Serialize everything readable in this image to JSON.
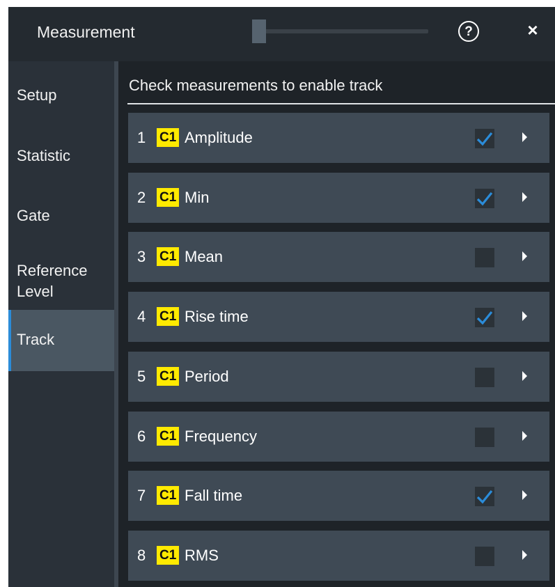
{
  "window": {
    "title": "Measurement",
    "help_icon": "?",
    "close_icon": "×"
  },
  "sidebar": {
    "items": [
      {
        "label": "Setup",
        "active": false
      },
      {
        "label": "Statistic",
        "active": false
      },
      {
        "label": "Gate",
        "active": false
      },
      {
        "label": "Reference Level",
        "active": false
      },
      {
        "label": "Track",
        "active": true
      }
    ]
  },
  "main": {
    "header": "Check measurements to enable track",
    "rows": [
      {
        "num": "1",
        "source": "C1",
        "name": "Amplitude",
        "checked": true
      },
      {
        "num": "2",
        "source": "C1",
        "name": "Min",
        "checked": true
      },
      {
        "num": "3",
        "source": "C1",
        "name": "Mean",
        "checked": false
      },
      {
        "num": "4",
        "source": "C1",
        "name": "Rise time",
        "checked": true
      },
      {
        "num": "5",
        "source": "C1",
        "name": "Period",
        "checked": false
      },
      {
        "num": "6",
        "source": "C1",
        "name": "Frequency",
        "checked": false
      },
      {
        "num": "7",
        "source": "C1",
        "name": "Fall time",
        "checked": true
      },
      {
        "num": "8",
        "source": "C1",
        "name": "RMS",
        "checked": false
      }
    ]
  },
  "colors": {
    "accent": "#2b8cd9",
    "badge": "#ffea00",
    "row_bg": "#3f4a55",
    "sidebar_bg": "#2a3139"
  }
}
